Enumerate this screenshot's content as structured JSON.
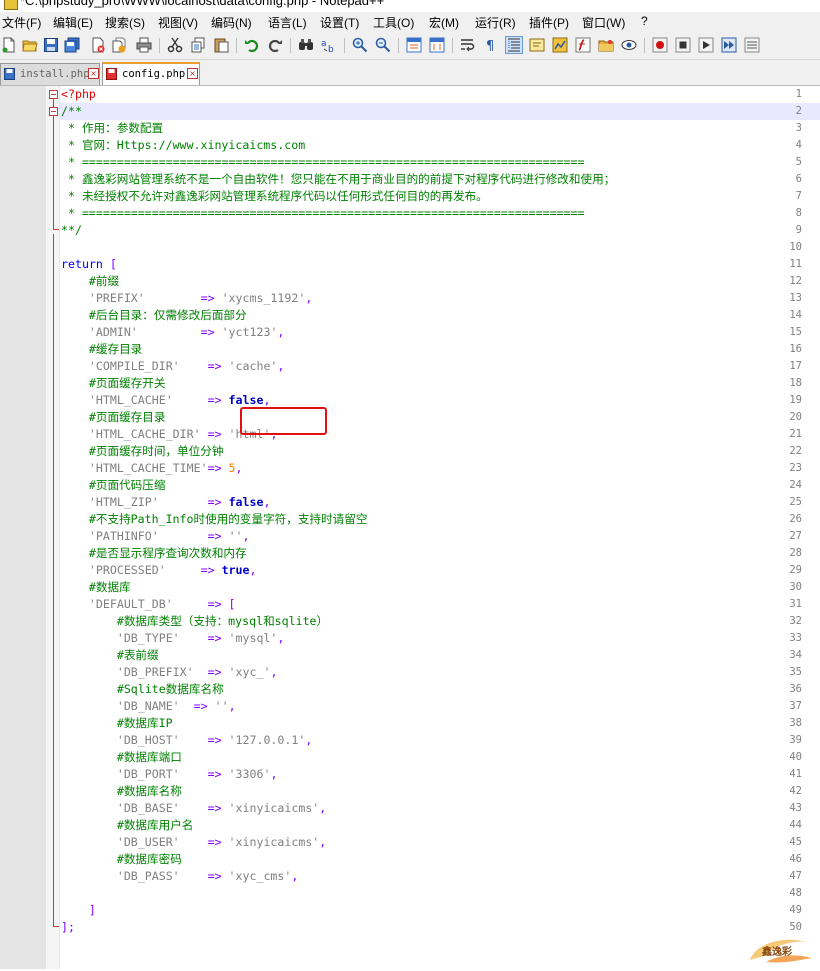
{
  "window": {
    "title": "*C:\\phpstudy_pro\\WWW\\localhost\\data\\config.php - Notepad++"
  },
  "menu": [
    "文件(F)",
    "编辑(E)",
    "搜索(S)",
    "视图(V)",
    "编码(N)",
    "语言(L)",
    "设置(T)",
    "工具(O)",
    "宏(M)",
    "运行(R)",
    "插件(P)",
    "窗口(W)",
    "?"
  ],
  "tabs": [
    {
      "label": "install.php",
      "active": false
    },
    {
      "label": "config.php",
      "active": true
    }
  ],
  "colors": {
    "php_tag": "#e00000",
    "comment": "#008000",
    "keyword": "#0000ff",
    "string": "#808080",
    "operator": "#8000ff",
    "number": "#ff8000",
    "boolean": "#0000c8",
    "annotation_box": "#e01010"
  },
  "editor": {
    "highlighted_line": 2,
    "annotated_line": 15,
    "lines": [
      {
        "n": "1",
        "seg": [
          {
            "t": "<?php",
            "c": "t-php"
          }
        ]
      },
      {
        "n": "2",
        "seg": [
          {
            "t": "/**",
            "c": "t-cm"
          }
        ]
      },
      {
        "n": "3",
        "seg": [
          {
            "t": " * 作用：参数配置",
            "c": "t-cm"
          }
        ]
      },
      {
        "n": "4",
        "seg": [
          {
            "t": " * 官网：Https://www.xinyicaicms.com",
            "c": "t-cm"
          }
        ]
      },
      {
        "n": "5",
        "seg": [
          {
            "t": " * ========================================================================",
            "c": "t-cm"
          }
        ]
      },
      {
        "n": "6",
        "seg": [
          {
            "t": " * 鑫逸彩网站管理系统不是一个自由软件！您只能在不用于商业目的的前提下对程序代码进行修改和使用；",
            "c": "t-cm"
          }
        ]
      },
      {
        "n": "7",
        "seg": [
          {
            "t": " * 未经授权不允许对鑫逸彩网站管理系统程序代码以任何形式任何目的的再发布。",
            "c": "t-cm"
          }
        ]
      },
      {
        "n": "8",
        "seg": [
          {
            "t": " * ========================================================================",
            "c": "t-cm"
          }
        ]
      },
      {
        "n": "9",
        "seg": [
          {
            "t": "**/",
            "c": "t-cm"
          }
        ]
      },
      {
        "n": "10",
        "seg": []
      },
      {
        "n": "11",
        "seg": [
          {
            "t": "return",
            "c": "t-kw"
          },
          {
            "t": " "
          },
          {
            "t": "[",
            "c": "t-br"
          }
        ]
      },
      {
        "n": "12",
        "seg": [
          {
            "t": "    #前缀",
            "c": "t-cm"
          }
        ]
      },
      {
        "n": "13",
        "seg": [
          {
            "t": "    "
          },
          {
            "t": "'PREFIX'",
            "c": "t-key"
          },
          {
            "t": "        "
          },
          {
            "t": "=>",
            "c": "t-op"
          },
          {
            "t": " "
          },
          {
            "t": "'xycms_1192'",
            "c": "t-str"
          },
          {
            "t": ",",
            "c": "t-op"
          }
        ]
      },
      {
        "n": "14",
        "seg": [
          {
            "t": "    #后台目录：仅需修改后面部分",
            "c": "t-cm"
          }
        ]
      },
      {
        "n": "15",
        "seg": [
          {
            "t": "    "
          },
          {
            "t": "'ADMIN'",
            "c": "t-key"
          },
          {
            "t": "         "
          },
          {
            "t": "=>",
            "c": "t-op"
          },
          {
            "t": " "
          },
          {
            "t": "'yct123'",
            "c": "t-str"
          },
          {
            "t": ",",
            "c": "t-op"
          }
        ]
      },
      {
        "n": "16",
        "seg": [
          {
            "t": "    #缓存目录",
            "c": "t-cm"
          }
        ]
      },
      {
        "n": "17",
        "seg": [
          {
            "t": "    "
          },
          {
            "t": "'COMPILE_DIR'",
            "c": "t-key"
          },
          {
            "t": "    "
          },
          {
            "t": "=>",
            "c": "t-op"
          },
          {
            "t": " "
          },
          {
            "t": "'cache'",
            "c": "t-str"
          },
          {
            "t": ",",
            "c": "t-op"
          }
        ]
      },
      {
        "n": "18",
        "seg": [
          {
            "t": "    #页面缓存开关",
            "c": "t-cm"
          }
        ]
      },
      {
        "n": "19",
        "seg": [
          {
            "t": "    "
          },
          {
            "t": "'HTML_CACHE'",
            "c": "t-key"
          },
          {
            "t": "     "
          },
          {
            "t": "=>",
            "c": "t-op"
          },
          {
            "t": " "
          },
          {
            "t": "false",
            "c": "t-bool"
          },
          {
            "t": ",",
            "c": "t-op"
          }
        ]
      },
      {
        "n": "20",
        "seg": [
          {
            "t": "    #页面缓存目录",
            "c": "t-cm"
          }
        ]
      },
      {
        "n": "21",
        "seg": [
          {
            "t": "    "
          },
          {
            "t": "'HTML_CACHE_DIR'",
            "c": "t-key"
          },
          {
            "t": " "
          },
          {
            "t": "=>",
            "c": "t-op"
          },
          {
            "t": " "
          },
          {
            "t": "'html'",
            "c": "t-str"
          },
          {
            "t": ",",
            "c": "t-op"
          }
        ]
      },
      {
        "n": "22",
        "seg": [
          {
            "t": "    #页面缓存时间，单位分钟",
            "c": "t-cm"
          }
        ]
      },
      {
        "n": "23",
        "seg": [
          {
            "t": "    "
          },
          {
            "t": "'HTML_CACHE_TIME'",
            "c": "t-key"
          },
          {
            "t": "=>",
            "c": "t-op"
          },
          {
            "t": " "
          },
          {
            "t": "5",
            "c": "t-num"
          },
          {
            "t": ",",
            "c": "t-op"
          }
        ]
      },
      {
        "n": "24",
        "seg": [
          {
            "t": "    #页面代码压缩",
            "c": "t-cm"
          }
        ]
      },
      {
        "n": "25",
        "seg": [
          {
            "t": "    "
          },
          {
            "t": "'HTML_ZIP'",
            "c": "t-key"
          },
          {
            "t": "       "
          },
          {
            "t": "=>",
            "c": "t-op"
          },
          {
            "t": " "
          },
          {
            "t": "false",
            "c": "t-bool"
          },
          {
            "t": ",",
            "c": "t-op"
          }
        ]
      },
      {
        "n": "26",
        "seg": [
          {
            "t": "    #不支持Path_Info时使用的变量字符，支持时请留空",
            "c": "t-cm"
          }
        ]
      },
      {
        "n": "27",
        "seg": [
          {
            "t": "    "
          },
          {
            "t": "'PATHINFO'",
            "c": "t-key"
          },
          {
            "t": "       "
          },
          {
            "t": "=>",
            "c": "t-op"
          },
          {
            "t": " "
          },
          {
            "t": "''",
            "c": "t-str"
          },
          {
            "t": ",",
            "c": "t-op"
          }
        ]
      },
      {
        "n": "28",
        "seg": [
          {
            "t": "    #是否显示程序查询次数和内存",
            "c": "t-cm"
          }
        ]
      },
      {
        "n": "29",
        "seg": [
          {
            "t": "    "
          },
          {
            "t": "'PROCESSED'",
            "c": "t-key"
          },
          {
            "t": "     "
          },
          {
            "t": "=>",
            "c": "t-op"
          },
          {
            "t": " "
          },
          {
            "t": "true",
            "c": "t-bool"
          },
          {
            "t": ",",
            "c": "t-op"
          }
        ]
      },
      {
        "n": "30",
        "seg": [
          {
            "t": "    #数据库",
            "c": "t-cm"
          }
        ]
      },
      {
        "n": "31",
        "seg": [
          {
            "t": "    "
          },
          {
            "t": "'DEFAULT_DB'",
            "c": "t-key"
          },
          {
            "t": "     "
          },
          {
            "t": "=>",
            "c": "t-op"
          },
          {
            "t": " "
          },
          {
            "t": "[",
            "c": "t-br"
          }
        ]
      },
      {
        "n": "32",
        "seg": [
          {
            "t": "        #数据库类型（支持：mysql和sqlite）",
            "c": "t-cm"
          }
        ]
      },
      {
        "n": "33",
        "seg": [
          {
            "t": "        "
          },
          {
            "t": "'DB_TYPE'",
            "c": "t-key"
          },
          {
            "t": "    "
          },
          {
            "t": "=>",
            "c": "t-op"
          },
          {
            "t": " "
          },
          {
            "t": "'mysql'",
            "c": "t-str"
          },
          {
            "t": ",",
            "c": "t-op"
          }
        ]
      },
      {
        "n": "34",
        "seg": [
          {
            "t": "        #表前缀",
            "c": "t-cm"
          }
        ]
      },
      {
        "n": "35",
        "seg": [
          {
            "t": "        "
          },
          {
            "t": "'DB_PREFIX'",
            "c": "t-key"
          },
          {
            "t": "  "
          },
          {
            "t": "=>",
            "c": "t-op"
          },
          {
            "t": " "
          },
          {
            "t": "'xyc_'",
            "c": "t-str"
          },
          {
            "t": ",",
            "c": "t-op"
          }
        ]
      },
      {
        "n": "36",
        "seg": [
          {
            "t": "        #Sqlite数据库名称",
            "c": "t-cm"
          }
        ]
      },
      {
        "n": "37",
        "seg": [
          {
            "t": "        "
          },
          {
            "t": "'DB_NAME'",
            "c": "t-key"
          },
          {
            "t": "  "
          },
          {
            "t": "=>",
            "c": "t-op"
          },
          {
            "t": " "
          },
          {
            "t": "''",
            "c": "t-str"
          },
          {
            "t": ",",
            "c": "t-op"
          }
        ]
      },
      {
        "n": "38",
        "seg": [
          {
            "t": "        #数据库IP",
            "c": "t-cm"
          }
        ]
      },
      {
        "n": "39",
        "seg": [
          {
            "t": "        "
          },
          {
            "t": "'DB_HOST'",
            "c": "t-key"
          },
          {
            "t": "    "
          },
          {
            "t": "=>",
            "c": "t-op"
          },
          {
            "t": " "
          },
          {
            "t": "'127.0.0.1'",
            "c": "t-str"
          },
          {
            "t": ",",
            "c": "t-op"
          }
        ]
      },
      {
        "n": "40",
        "seg": [
          {
            "t": "        #数据库端口",
            "c": "t-cm"
          }
        ]
      },
      {
        "n": "41",
        "seg": [
          {
            "t": "        "
          },
          {
            "t": "'DB_PORT'",
            "c": "t-key"
          },
          {
            "t": "    "
          },
          {
            "t": "=>",
            "c": "t-op"
          },
          {
            "t": " "
          },
          {
            "t": "'3306'",
            "c": "t-str"
          },
          {
            "t": ",",
            "c": "t-op"
          }
        ]
      },
      {
        "n": "42",
        "seg": [
          {
            "t": "        #数据库名称",
            "c": "t-cm"
          }
        ]
      },
      {
        "n": "43",
        "seg": [
          {
            "t": "        "
          },
          {
            "t": "'DB_BASE'",
            "c": "t-key"
          },
          {
            "t": "    "
          },
          {
            "t": "=>",
            "c": "t-op"
          },
          {
            "t": " "
          },
          {
            "t": "'xinyicaicms'",
            "c": "t-str"
          },
          {
            "t": ",",
            "c": "t-op"
          }
        ]
      },
      {
        "n": "44",
        "seg": [
          {
            "t": "        #数据库用户名",
            "c": "t-cm"
          }
        ]
      },
      {
        "n": "45",
        "seg": [
          {
            "t": "        "
          },
          {
            "t": "'DB_USER'",
            "c": "t-key"
          },
          {
            "t": "    "
          },
          {
            "t": "=>",
            "c": "t-op"
          },
          {
            "t": " "
          },
          {
            "t": "'xinyicaicms'",
            "c": "t-str"
          },
          {
            "t": ",",
            "c": "t-op"
          }
        ]
      },
      {
        "n": "46",
        "seg": [
          {
            "t": "        #数据库密码",
            "c": "t-cm"
          }
        ]
      },
      {
        "n": "47",
        "seg": [
          {
            "t": "        "
          },
          {
            "t": "'DB_PASS'",
            "c": "t-key"
          },
          {
            "t": "    "
          },
          {
            "t": "=>",
            "c": "t-op"
          },
          {
            "t": " "
          },
          {
            "t": "'xyc_cms'",
            "c": "t-str"
          },
          {
            "t": ",",
            "c": "t-op"
          }
        ]
      },
      {
        "n": "48",
        "seg": []
      },
      {
        "n": "49",
        "seg": [
          {
            "t": "    "
          },
          {
            "t": "]",
            "c": "t-br"
          }
        ]
      },
      {
        "n": "50",
        "seg": [
          {
            "t": "]",
            "c": "t-br"
          },
          {
            "t": ";",
            "c": "t-op"
          }
        ]
      }
    ]
  },
  "watermark": {
    "text": "鑫逸彩"
  }
}
